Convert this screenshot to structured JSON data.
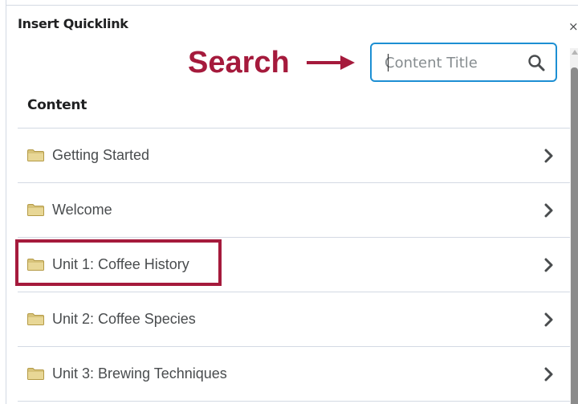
{
  "dialog": {
    "title": "Insert Quicklink",
    "close_glyph": "×"
  },
  "annotation": {
    "label": "Search",
    "color": "#a51a3c"
  },
  "search": {
    "placeholder": "Content Title",
    "value": "",
    "icon": "search-icon",
    "border_color": "#1d8fd3"
  },
  "content": {
    "heading": "Content",
    "items": [
      {
        "label": "Getting Started",
        "icon": "folder-icon"
      },
      {
        "label": "Welcome",
        "icon": "folder-icon"
      },
      {
        "label": "Unit 1: Coffee History",
        "icon": "folder-icon",
        "highlighted": true
      },
      {
        "label": "Unit 2: Coffee Species",
        "icon": "folder-icon"
      },
      {
        "label": "Unit 3: Brewing Techniques",
        "icon": "folder-icon"
      }
    ]
  }
}
